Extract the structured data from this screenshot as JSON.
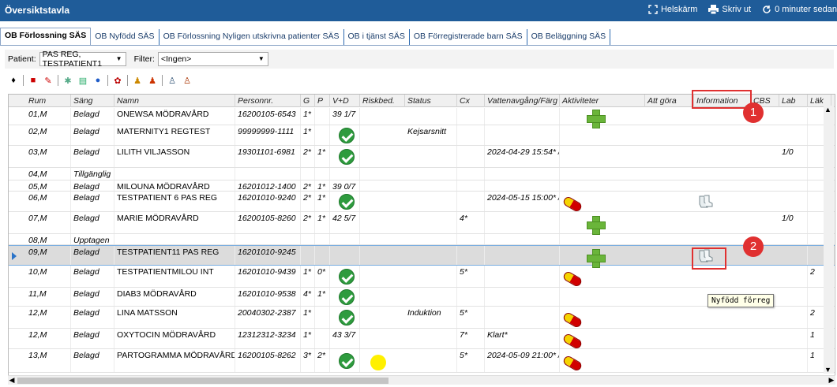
{
  "window": {
    "title": "Översiktstavla",
    "fullscreen_label": "Helskärm",
    "print_label": "Skriv ut",
    "refresh_label": "0 minuter sedan"
  },
  "tabs": [
    {
      "label": "OB Förlossning SÄS",
      "active": true
    },
    {
      "label": "OB Nyfödd SÄS"
    },
    {
      "label": "OB Förlossning Nyligen utskrivna patienter SÄS"
    },
    {
      "label": "OB i tjänst SÄS"
    },
    {
      "label": "OB Förregistrerade barn SÄS"
    },
    {
      "label": "OB Beläggning SÄS"
    }
  ],
  "filters": {
    "patient_label": "Patient:",
    "patient_value": "PAS REG, TESTPATIENT1",
    "filter_label": "Filter:",
    "filter_value": "<Ingen>"
  },
  "columns": [
    "Rum",
    "Säng",
    "Namn",
    "Personnr.",
    "G",
    "P",
    "V+D",
    "Riskbed.",
    "Status",
    "Cx",
    "Vattenavgång/Färg",
    "Aktiviteter",
    "Att göra",
    "Information",
    "CBS",
    "Lab",
    "Läk"
  ],
  "rows": [
    {
      "rum": "01,M",
      "sang": "Belagd",
      "namn": "ONEWSA MÖDRAVÅRD",
      "pnr": "16200105-6543",
      "g": "1*",
      "p": "",
      "vd": "39 1/7",
      "status": "",
      "cx": "",
      "vatten": "",
      "lab": "",
      "lak": "",
      "icons": [
        "plus"
      ]
    },
    {
      "rum": "02,M",
      "sang": "Belagd",
      "namn": "MATERNITY1 REGTEST",
      "pnr": "99999999-1111",
      "g": "1*",
      "p": "",
      "vd": "",
      "status": "Kejsarsnitt",
      "cx": "",
      "vatten": "",
      "lab": "",
      "lak": "",
      "icons": [
        "check"
      ]
    },
    {
      "rum": "03,M",
      "sang": "Belagd",
      "namn": "LILITH VILJASSON",
      "pnr": "19301101-6981",
      "g": "2*",
      "p": "1*",
      "vd": "",
      "status": "",
      "cx": "",
      "vatten": "2024-04-29 15:54* /",
      "lab": "1/0",
      "lak": "",
      "icons": [
        "check"
      ]
    },
    {
      "rum": "04,M",
      "sang": "Tillgänglig",
      "namn": "",
      "pnr": "",
      "g": "",
      "p": "",
      "vd": "",
      "status": "",
      "cx": "",
      "vatten": "",
      "lab": "",
      "lak": "",
      "icons": []
    },
    {
      "rum": "05,M",
      "sang": "Belagd",
      "namn": "MILOUNA MÖDRAVÅRD",
      "pnr": "16201012-1400",
      "g": "2*",
      "p": "1*",
      "vd": "39 0/7",
      "status": "",
      "cx": "",
      "vatten": "",
      "lab": "",
      "lak": "",
      "icons": []
    },
    {
      "rum": "06,M",
      "sang": "Belagd",
      "namn": "TESTPATIENT 6 PAS REG",
      "pnr": "16201010-9240",
      "g": "2*",
      "p": "1*",
      "vd": "",
      "status": "",
      "cx": "",
      "vatten": "2024-05-15 15:00* /",
      "lab": "",
      "lak": "",
      "icons": [
        "check",
        "pill",
        "socks"
      ]
    },
    {
      "rum": "07,M",
      "sang": "Belagd",
      "namn": "MARIE MÖDRAVÅRD",
      "pnr": "16200105-8260",
      "g": "2*",
      "p": "1*",
      "vd": "42 5/7",
      "status": "",
      "cx": "4*",
      "vatten": "",
      "lab": "1/0",
      "lak": "",
      "icons": [
        "plus"
      ]
    },
    {
      "rum": "08,M",
      "sang": "Upptagen",
      "namn": "",
      "pnr": "",
      "g": "",
      "p": "",
      "vd": "",
      "status": "",
      "cx": "",
      "vatten": "",
      "lab": "",
      "lak": "",
      "icons": []
    },
    {
      "rum": "09,M",
      "sang": "Belagd",
      "namn": "TESTPATIENT11 PAS REG",
      "pnr": "16201010-9245",
      "g": "",
      "p": "",
      "vd": "",
      "status": "",
      "cx": "",
      "vatten": "",
      "lab": "",
      "lak": "",
      "icons": [
        "plus",
        "socks"
      ],
      "selected": true
    },
    {
      "rum": "10,M",
      "sang": "Belagd",
      "namn": "TESTPATIENTMILOU INT",
      "pnr": "16201010-9439",
      "g": "1*",
      "p": "0*",
      "vd": "",
      "status": "",
      "cx": "5*",
      "vatten": "",
      "lab": "",
      "lak": "2",
      "icons": [
        "check",
        "pill"
      ]
    },
    {
      "rum": "11,M",
      "sang": "Belagd",
      "namn": "DIAB3 MÖDRAVÅRD",
      "pnr": "16201010-9538",
      "g": "4*",
      "p": "1*",
      "vd": "",
      "status": "",
      "cx": "",
      "vatten": "",
      "lab": "",
      "lak": "",
      "icons": [
        "check"
      ]
    },
    {
      "rum": "12,M",
      "sang": "Belagd",
      "namn": "LINA MATSSON",
      "pnr": "20040302-2387",
      "g": "1*",
      "p": "",
      "vd": "",
      "status": "Induktion",
      "cx": "5*",
      "vatten": "",
      "lab": "",
      "lak": "2",
      "icons": [
        "check",
        "pill"
      ]
    },
    {
      "rum": "12,M",
      "sang": "Belagd",
      "namn": "OXYTOCIN MÖDRAVÅRD",
      "pnr": "12312312-3234",
      "g": "1*",
      "p": "",
      "vd": "43 3/7",
      "status": "",
      "cx": "7*",
      "vatten": "Klart*",
      "lab": "",
      "lak": "1",
      "icons": [
        "pill"
      ]
    },
    {
      "rum": "13,M",
      "sang": "Belagd",
      "namn": "PARTOGRAMMA MÖDRAVÅRD",
      "pnr": "16200105-8262",
      "g": "3*",
      "p": "2*",
      "vd": "",
      "status": "",
      "cx": "5*",
      "vatten": "2024-05-09 21:00* /",
      "lab": "",
      "lak": "1",
      "icons": [
        "check",
        "yellow",
        "pill"
      ]
    }
  ],
  "tooltip": "Nyfödd förreg",
  "callouts": [
    "1",
    "2"
  ],
  "colors": {
    "titlebar": "#1f5c99",
    "callout": "#e03030",
    "check": "#2e9b3e",
    "plus": "#6ab53a"
  }
}
